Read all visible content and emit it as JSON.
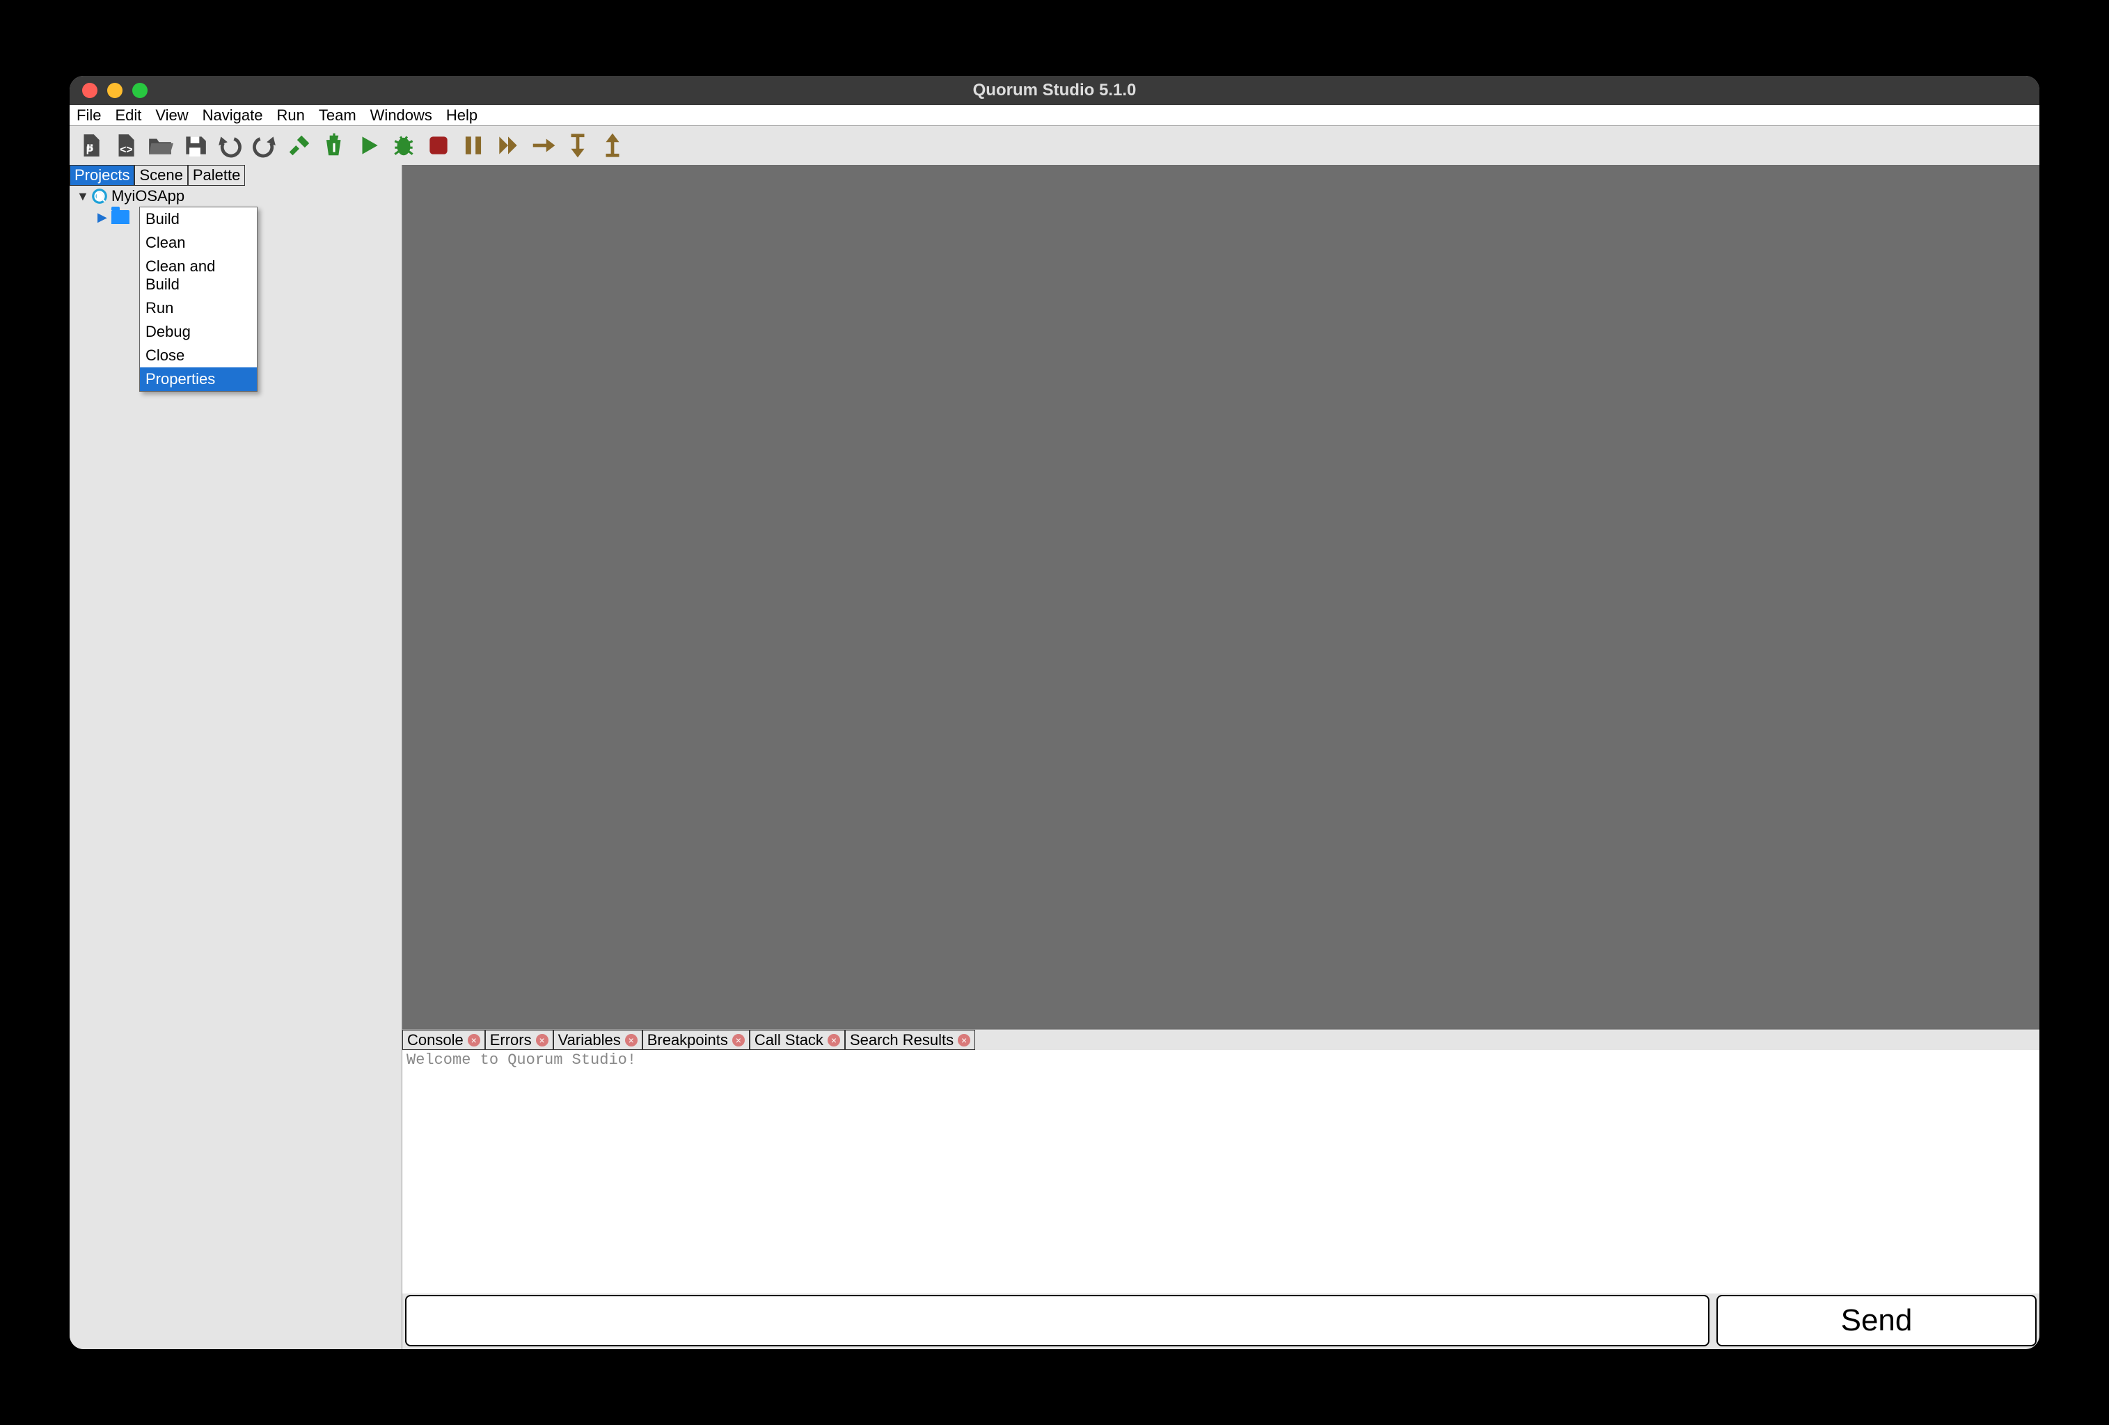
{
  "window_title": "Quorum Studio 5.1.0",
  "menus": [
    "File",
    "Edit",
    "View",
    "Navigate",
    "Run",
    "Team",
    "Windows",
    "Help"
  ],
  "toolbar_icons": [
    "new-project-icon",
    "new-file-icon",
    "open-icon",
    "save-icon",
    "undo-icon",
    "redo-icon",
    "build-icon",
    "clean-build-icon",
    "run-icon",
    "debug-icon",
    "stop-icon",
    "pause-icon",
    "continue-icon",
    "step-over-icon",
    "step-into-icon",
    "step-out-icon"
  ],
  "left_tabs": [
    "Projects",
    "Scene",
    "Palette"
  ],
  "left_active_tab": "Projects",
  "tree": {
    "root": "MyiOSApp",
    "child": ""
  },
  "context_menu": [
    "Build",
    "Clean",
    "Clean and Build",
    "Run",
    "Debug",
    "Close",
    "Properties"
  ],
  "context_highlight": "Properties",
  "bottom_tabs": [
    "Console",
    "Errors",
    "Variables",
    "Breakpoints",
    "Call Stack",
    "Search Results"
  ],
  "console_text": "Welcome to Quorum Studio!",
  "send_label": "Send"
}
